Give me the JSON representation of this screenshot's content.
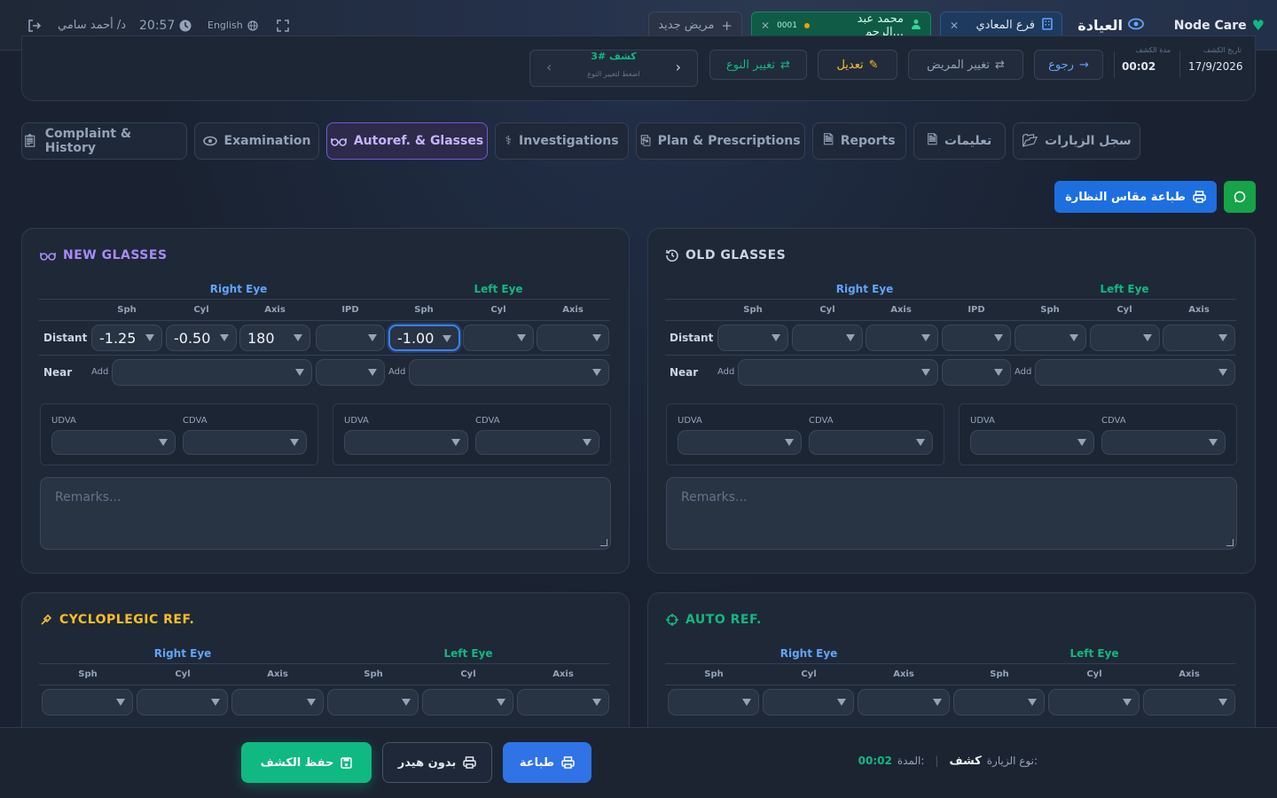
{
  "topbar": {
    "brand": "Node Care",
    "clinic": "العيادة",
    "branch": "فرع المعادي",
    "patient_name": "محمد عبد الرحم...",
    "patient_code": "0001",
    "new_patient": "مريض جديد",
    "language": "English",
    "time": "20:57",
    "doctor": "د/ أحمد سامي"
  },
  "summary": {
    "date_label": "تاريخ الكشف",
    "date_value": "17/9/2026",
    "duration_label": "مدة الكشف",
    "duration_value": "00:02",
    "back": "رجوع",
    "change_patient": "تغيير المريض",
    "edit": "تعديل",
    "change_type": "تغيير النوع",
    "visit_badge": "كشف #3",
    "visit_hint": "اضغط لتغيير النوع"
  },
  "tabs": [
    {
      "label": "Complaint & History",
      "icon": "clipboard-icon"
    },
    {
      "label": "Examination",
      "icon": "eye-icon"
    },
    {
      "label": "Autoref. & Glasses",
      "icon": "glasses-icon"
    },
    {
      "label": "Investigations",
      "icon": "microscope-icon"
    },
    {
      "label": "Plan & Prescriptions",
      "icon": "prescription-icon"
    },
    {
      "label": "Reports",
      "icon": "file-icon"
    },
    {
      "label": "تعليمات",
      "icon": "instructions-icon"
    },
    {
      "label": "سجل الزيارات",
      "icon": "folder-icon"
    }
  ],
  "actions": {
    "print_glasses": "طباعة مقاس النظارة"
  },
  "new_glasses": {
    "title": "NEW GLASSES",
    "right_eye": "Right Eye",
    "left_eye": "Left Eye",
    "cols": [
      "Sph",
      "Cyl",
      "Axis",
      "IPD",
      "Sph",
      "Cyl",
      "Axis"
    ],
    "distant": "Distant",
    "near": "Near",
    "add": "Add",
    "values": [
      "-1.25",
      "-0.50",
      "180",
      "",
      "-1.00",
      "",
      ""
    ],
    "udva": "UDVA",
    "cdva": "CDVA",
    "remarks_placeholder": "Remarks..."
  },
  "old_glasses": {
    "title": "OLD GLASSES",
    "right_eye": "Right Eye",
    "left_eye": "Left Eye",
    "cols": [
      "Sph",
      "Cyl",
      "Axis",
      "IPD",
      "Sph",
      "Cyl",
      "Axis"
    ],
    "distant": "Distant",
    "near": "Near",
    "add": "Add",
    "udva": "UDVA",
    "cdva": "CDVA",
    "remarks_placeholder": "Remarks..."
  },
  "cyclo": {
    "title": "CYCLOPLEGIC REF.",
    "right_eye": "Right Eye",
    "left_eye": "Left Eye",
    "cols": [
      "Sph",
      "Cyl",
      "Axis",
      "Sph",
      "Cyl",
      "Axis"
    ]
  },
  "auto": {
    "title": "AUTO REF.",
    "right_eye": "Right Eye",
    "left_eye": "Left Eye",
    "cols": [
      "Sph",
      "Cyl",
      "Axis",
      "Sph",
      "Cyl",
      "Axis"
    ]
  },
  "footer": {
    "visit_type_label": "نوع الزيارة:",
    "visit_type_value": "كشف",
    "duration_label": "المدة:",
    "duration_value": "00:02",
    "print": "طباعة",
    "no_header": "بدون هيدر",
    "save": "حفظ الكشف"
  }
}
